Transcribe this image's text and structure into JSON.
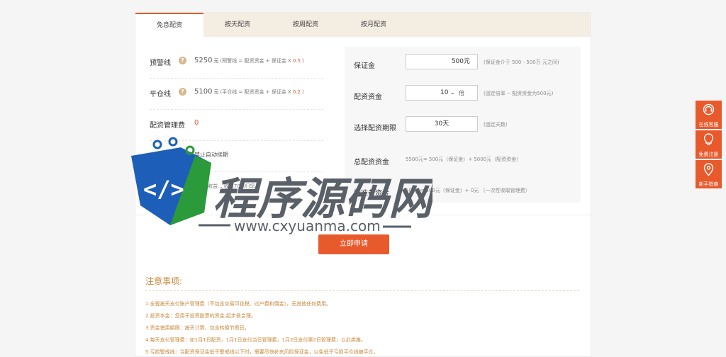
{
  "tabs": [
    {
      "label": "免息配资",
      "active": true
    },
    {
      "label": "按天配资",
      "active": false
    },
    {
      "label": "按周配资",
      "active": false
    },
    {
      "label": "按月配资",
      "active": false
    }
  ],
  "left": {
    "warning": {
      "label": "预警线",
      "value": "5250",
      "unit": "元",
      "formula": "(预警线 = 配资资金 + 保证金 X",
      "ratio": "0.5",
      "close": ")"
    },
    "closeout": {
      "label": "平仓线",
      "value": "5100",
      "unit": "元",
      "formula": "(平仓线 = 配资资金 + 保证金 X",
      "ratio": "0.2",
      "close": ")"
    },
    "fee": {
      "label": "配资管理费",
      "value": "0"
    },
    "renew": {
      "label": "禁止自动续期"
    },
    "profit_note": "中保收益... 收益70%归您。"
  },
  "right": {
    "margin": {
      "label": "保证金",
      "value": "500元",
      "hint": "(保证金介于 500 - 500万 元之间)"
    },
    "multiple": {
      "label": "配资资金",
      "value": "10",
      "chevron": "⌄",
      "unit": "倍",
      "hint": "(固定倍率 -- 配资资金为500元)"
    },
    "period": {
      "label": "选择配资期限",
      "value": "30天",
      "hint": "(固定天数)"
    },
    "total": {
      "label": "总配资资金",
      "calc": "5500元= 500元（保证金）+ 5000元（配资资金）"
    },
    "need": {
      "label": "需准备资金",
      "calc": "500元= 500元（保证金）+ 0元 （一次性收取管理费）"
    }
  },
  "submit": {
    "label": "立即申请"
  },
  "notes": {
    "title": "注意事项:",
    "items": [
      "1.全程按天支付账户管理费（不包含交易印花税、过户费和佣金），无其他任何费用。",
      "2.投资本金：您用于投资股票的资金,起步很合理。",
      "3.资金使用期限：按天计算，包含转换节假日。",
      "4.每天支付管理费：如1月1日配资，1月1日支付当日管理费，1月2日支付第2日管理费，以此类推。",
      "5.亏损警戒线：当配资保证金低于警戒线以下时，需要尽快补充风险保证金，以免低于亏损平仓线被平仓。"
    ]
  },
  "sidebar": [
    {
      "label": "在线客服",
      "icon": "headset-icon"
    },
    {
      "label": "免费注册",
      "icon": "lightbulb-icon"
    },
    {
      "label": "新手指南",
      "icon": "location-pin-icon"
    }
  ],
  "watermark": {
    "title": "程序源码网",
    "url": "www.cxyuanma.com",
    "colors": {
      "blue": "#1d5fb8",
      "green": "#2b9a3a",
      "red": "#e8502a",
      "gray": "#5a6068"
    }
  },
  "colors": {
    "accent": "#e85a2c",
    "tab_bg": "#f4ede2",
    "note": "#c8883a"
  }
}
